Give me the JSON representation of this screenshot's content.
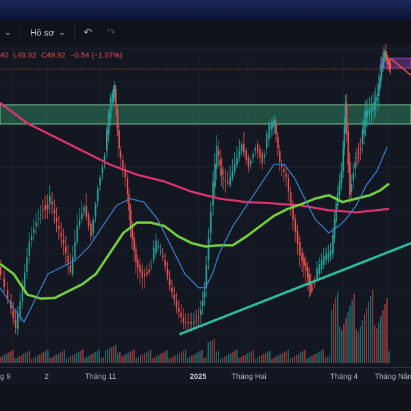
{
  "toolbar": {
    "profile_label": "Hồ sơ",
    "profile_chevron": "chevron-down-icon",
    "left_chevron": "chevron-down-icon",
    "undo_icon": "undo-icon",
    "redo_icon": "redo-icon"
  },
  "ohlc": {
    "open_fragment": "40",
    "low": "L49.92",
    "close": "C49.92",
    "change": "−0.54 (−1.07%)",
    "up_color": "#ef5350"
  },
  "xaxis": {
    "labels": [
      "g 9",
      "2",
      "Tháng 11",
      "2025",
      "Tháng Hai",
      "Tháng 4",
      "Tháng Năm"
    ]
  },
  "colors": {
    "bull": "#26a69a",
    "bear": "#ef5350",
    "ma_fast": "#3d87d9",
    "ma_mid": "#76d13c",
    "ma_slow": "#e6336f",
    "trendline": "#2bbfa2",
    "zone": "#2e7d5b",
    "zone_border": "#8fe3a5",
    "box": "#b04acb"
  },
  "chart_data": {
    "type": "candlestick",
    "x_ticks": [
      "g 9",
      "2",
      "Tháng 11",
      "2025",
      "Tháng Hai",
      "Tháng 4",
      "Tháng Năm"
    ],
    "last": {
      "low": 49.92,
      "close": 49.92,
      "change": -0.54,
      "change_pct": -1.07
    },
    "series": [
      {
        "name": "",
        "kind": "moving-average-fast"
      },
      {
        "name": "",
        "kind": "moving-average-mid"
      },
      {
        "name": "",
        "kind": "moving-average-slow"
      }
    ]
  }
}
